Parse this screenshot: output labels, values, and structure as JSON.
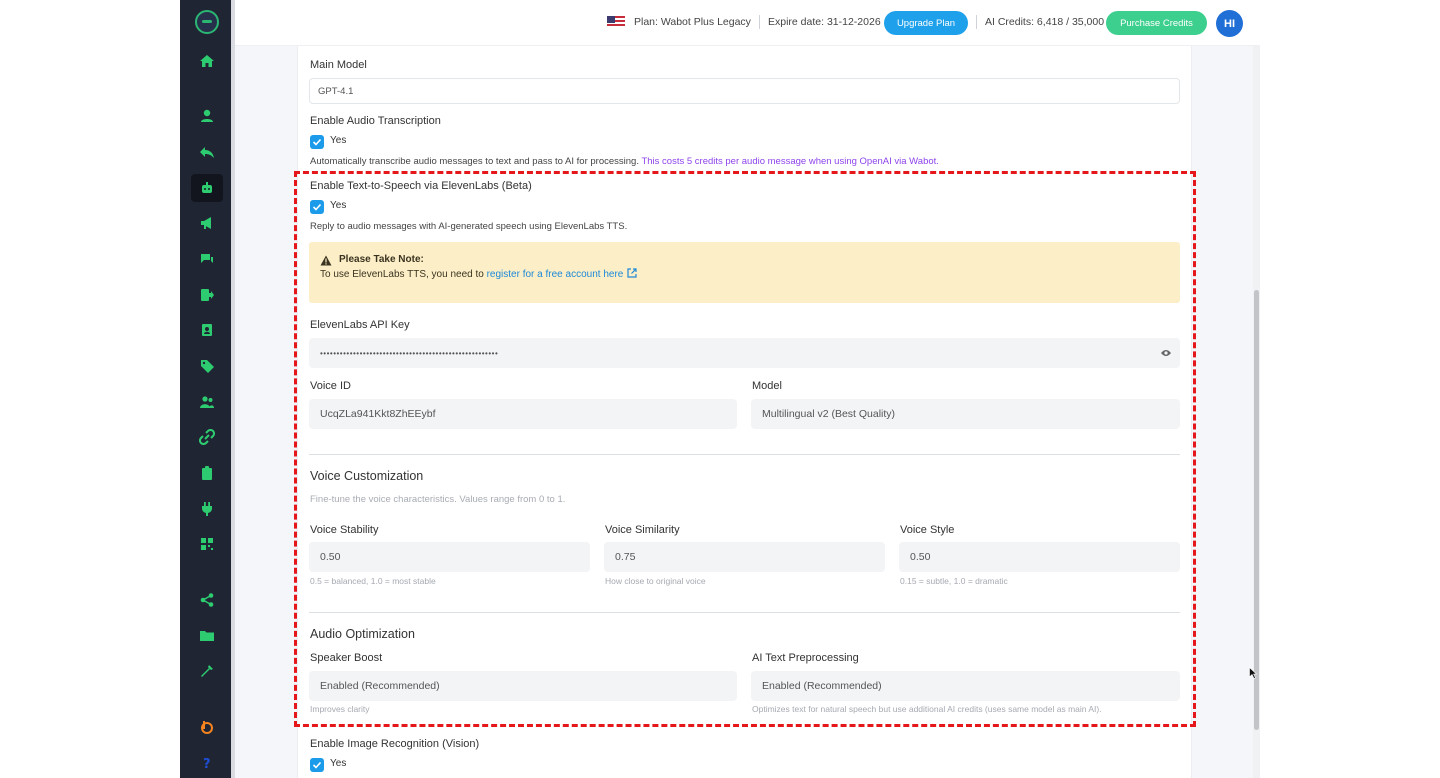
{
  "topbar": {
    "plan": "Plan: Wabot Plus Legacy",
    "expire": "Expire date: 31-12-2026",
    "upgrade_label": "Upgrade Plan",
    "credits": "AI Credits: 6,418 / 35,000",
    "purchase_label": "Purchase Credits",
    "avatar_initials": "HI"
  },
  "sidebar": {
    "items": [
      "home-icon",
      "user-icon",
      "reply-icon",
      "robot-icon",
      "megaphone-icon",
      "chat-icon",
      "export-icon",
      "contact-card-icon",
      "tag-icon",
      "users-icon",
      "link-icon",
      "clipboard-icon",
      "plug-icon",
      "qr-code-icon",
      "share-icon",
      "folder-icon",
      "tools-icon",
      "brand-icon",
      "help-icon"
    ]
  },
  "form": {
    "main_model": {
      "label": "Main Model",
      "value": "GPT-4.1"
    },
    "audio_transcription": {
      "label": "Enable Audio Transcription",
      "check_label": "Yes",
      "help": "Automatically transcribe audio messages to text and pass to AI for processing.",
      "help_cost": "This costs 5 credits per audio message when using OpenAI via Wabot."
    },
    "tts": {
      "label": "Enable Text-to-Speech via ElevenLabs (Beta)",
      "check_label": "Yes",
      "help": "Reply to audio messages with AI-generated speech using ElevenLabs TTS."
    },
    "note": {
      "title": "Please Take Note:",
      "text": "To use ElevenLabs TTS, you need to",
      "link": "register for a free account here"
    },
    "api_key": {
      "label": "ElevenLabs API Key",
      "value": "••••••••••••••••••••••••••••••••••••••••••••••••••••••"
    },
    "voice_id": {
      "label": "Voice ID",
      "value": "UcqZLa941Kkt8ZhEEybf"
    },
    "model": {
      "label": "Model",
      "value": "Multilingual v2 (Best Quality)"
    },
    "voice_customization": {
      "title": "Voice Customization",
      "subtitle": "Fine-tune the voice characteristics. Values range from 0 to 1."
    },
    "stability": {
      "label": "Voice Stability",
      "value": "0.50",
      "hint": "0.5 = balanced, 1.0 = most stable"
    },
    "similarity": {
      "label": "Voice Similarity",
      "value": "0.75",
      "hint": "How close to original voice"
    },
    "style": {
      "label": "Voice Style",
      "value": "0.50",
      "hint": "0.15 = subtle, 1.0 = dramatic"
    },
    "audio_optimization": {
      "title": "Audio Optimization"
    },
    "speaker_boost": {
      "label": "Speaker Boost",
      "value": "Enabled (Recommended)",
      "hint": "Improves clarity"
    },
    "preprocessing": {
      "label": "AI Text Preprocessing",
      "value": "Enabled (Recommended)",
      "hint": "Optimizes text for natural speech but use additional AI credits (uses same model as main AI)."
    },
    "vision": {
      "label": "Enable Image Recognition (Vision)",
      "check_label": "Yes"
    }
  },
  "colors": {
    "sidebar": "#1f2532",
    "accent_green": "#2ecc71",
    "accent_blue": "#1c9bea",
    "highlight_red": "#e5171b",
    "note_bg": "#fcefc7"
  }
}
